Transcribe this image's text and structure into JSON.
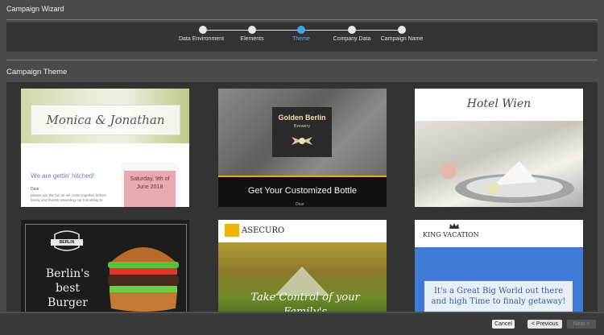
{
  "window": {
    "title": "Campaign Wizard"
  },
  "stepper": {
    "steps": [
      {
        "label": "Data Environment"
      },
      {
        "label": "Elements"
      },
      {
        "label": "Theme"
      },
      {
        "label": "Company Data"
      },
      {
        "label": "Campaign Name"
      }
    ],
    "active_index": 2
  },
  "section": {
    "title": "Campaign Theme"
  },
  "themes": [
    {
      "heading": "Monica & Jonathan",
      "tagline": "We are gettin' hitched!",
      "greeting": "Dear ,",
      "body": "please join the fun as we come together before family and friends extending our friendship to",
      "date": "Saturday, 9th of June 2018"
    },
    {
      "brand": "Golden Berlin",
      "sub": "Brewery",
      "cta": "Get Your Customized Bottle",
      "footer_text": "Dear"
    },
    {
      "brand": "Hotel Wien"
    },
    {
      "badge": "BERLIN",
      "headline": "Berlin's best Burger"
    },
    {
      "brand": "ASECURO",
      "headline": "Take Control of your Family's"
    },
    {
      "brand": "KING VACATION",
      "headline": "It's a Great Big World out there and high Time to finaly getaway!"
    }
  ],
  "footer": {
    "cancel_label": "Cancel",
    "prev_label": "< Previous",
    "next_label": "Next >"
  },
  "colors": {
    "accent": "#3aa7e6",
    "background": "#4a4a4a",
    "panel": "#333333"
  }
}
